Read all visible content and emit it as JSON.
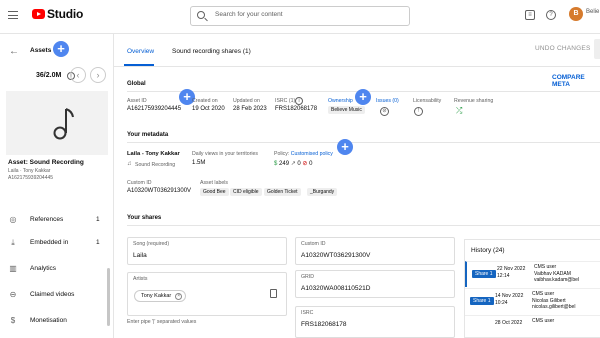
{
  "app": {
    "name": "Studio",
    "account": "Belie"
  },
  "search": {
    "placeholder": "Search for your content"
  },
  "sidebar": {
    "title": "Assets",
    "counter": "36/2.0M",
    "asset_title": "Asset: Sound Recording",
    "asset_artist": "Laila · Tony Kakkar",
    "asset_id": "A162175939204445",
    "items": [
      {
        "label": "References",
        "count": "1",
        "icon": "references-icon"
      },
      {
        "label": "Embedded in",
        "count": "1",
        "icon": "embedded-icon"
      },
      {
        "label": "Analytics",
        "count": "",
        "icon": "analytics-icon"
      },
      {
        "label": "Claimed videos",
        "count": "",
        "icon": "claimed-videos-icon"
      },
      {
        "label": "Monetisation",
        "count": "",
        "icon": "monetisation-icon"
      }
    ]
  },
  "tabs": [
    {
      "label": "Overview",
      "active": true
    },
    {
      "label": "Sound recording shares (1)",
      "active": false
    }
  ],
  "toolbar": {
    "undo_label": "UNDO CHANGES",
    "compare_label": "COMPARE META"
  },
  "global": {
    "title": "Global",
    "asset_id_label": "Asset ID",
    "asset_id": "A162175939204445",
    "created_label": "Created on",
    "created": "19 Oct 2020",
    "updated_label": "Updated on",
    "updated": "28 Feb 2023",
    "isrc_label": "ISRC (1)",
    "isrc": "FRS182068178",
    "ownership_label": "Ownership",
    "ownership": "Believe Music",
    "issues_label": "Issues (0)",
    "licensability_label": "Licensability",
    "revenue_label": "Revenue sharing"
  },
  "metadata": {
    "title": "Your metadata",
    "song_title": "Laila - Tony Kakkar",
    "song_type": "Sound Recording",
    "daily_views_label": "Daily views in your territories",
    "daily_views": "1.5M",
    "policy_label": "Policy:",
    "policy_name": "Customised policy",
    "policy_counts": [
      "249",
      "0",
      "0"
    ],
    "custom_id_label": "Custom ID",
    "custom_id": "A10320WT036291300V",
    "asset_labels_label": "Asset labels",
    "asset_labels": [
      "Good Bee",
      "CID eligible",
      "Golden Ticket",
      "_Burgandy"
    ]
  },
  "shares": {
    "title": "Your shares",
    "song_label": "Song (required)",
    "song": "Laila",
    "artists_label": "Artists",
    "artist_chip": "Tony Kakkar",
    "artists_hint": "Enter pipe '|' separated values",
    "custom_id_label": "Custom ID",
    "custom_id": "A10320WT036291300V",
    "grid_label": "GRID",
    "grid": "A10320WA008110521D",
    "isrc_label": "ISRC",
    "isrc": "FRS182068178"
  },
  "history": {
    "title": "History (24)",
    "rows": [
      {
        "badge": "Share 1",
        "date": "22 Nov 2022",
        "time": "12:14",
        "role": "CMS user",
        "name": "Vaibhav KADAM",
        "email": "vaibhav.kadam@bel"
      },
      {
        "badge": "Share 1",
        "date": "14 Nov 2022",
        "time": "10:24",
        "role": "CMS user",
        "name": "Nicolas Gilibert",
        "email": "nicolas.gilibert@bel"
      },
      {
        "badge": "",
        "date": "28 Oct 2022",
        "time": "",
        "role": "CMS user",
        "name": "",
        "email": ""
      }
    ]
  },
  "colors": {
    "accent": "#065fd4",
    "plus_button": "#4f86ef",
    "brand_red": "#ff0000",
    "badge_blue": "#1565c0"
  }
}
